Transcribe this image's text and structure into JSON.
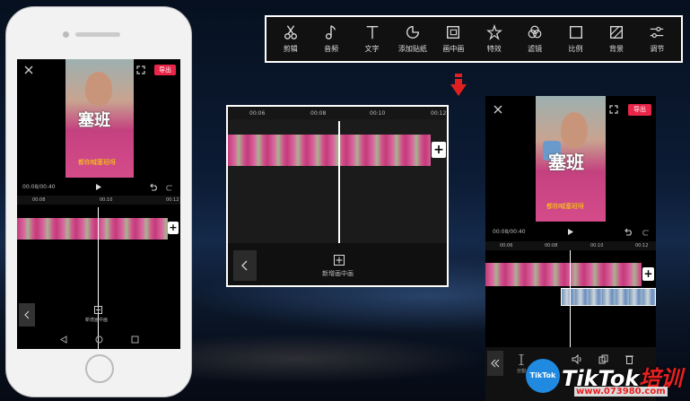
{
  "toolbar": {
    "items": [
      {
        "label": "剪辑",
        "icon": "scissors-icon"
      },
      {
        "label": "音频",
        "icon": "music-note-icon"
      },
      {
        "label": "文字",
        "icon": "text-icon"
      },
      {
        "label": "添加贴纸",
        "icon": "sticker-icon"
      },
      {
        "label": "画中画",
        "icon": "picture-in-picture-icon"
      },
      {
        "label": "特效",
        "icon": "sparkle-star-icon"
      },
      {
        "label": "滤镜",
        "icon": "filter-circles-icon"
      },
      {
        "label": "比例",
        "icon": "ratio-square-icon"
      },
      {
        "label": "背景",
        "icon": "background-hatch-icon"
      },
      {
        "label": "调节",
        "icon": "sliders-icon"
      }
    ]
  },
  "phone": {
    "export_label": "导出",
    "caption_big": "塞班",
    "caption_small": "都你喊塞班呀",
    "time": "00:08/00:40",
    "ticks": [
      "00:08",
      "00:10",
      "00:12"
    ],
    "add_pip_label": "新增画中画"
  },
  "middle": {
    "ticks": [
      "00:06",
      "00:08",
      "00:10",
      "00:12"
    ],
    "add_pip_label": "新增画中画"
  },
  "right": {
    "export_label": "导出",
    "caption_big": "塞班",
    "caption_small": "都你喊塞班呀",
    "time": "00:08/00:40",
    "ticks": [
      "00:06",
      "00:08",
      "00:10",
      "00:12"
    ],
    "bottom_label": "分割"
  },
  "watermark": {
    "logo_text": "TikTok",
    "brand": "TikTok",
    "brand_cn": "培训",
    "url": "www.073980.com"
  },
  "colors": {
    "accent": "#e8264a",
    "arrow": "#e02020",
    "caption_yellow": "#ffd800"
  }
}
